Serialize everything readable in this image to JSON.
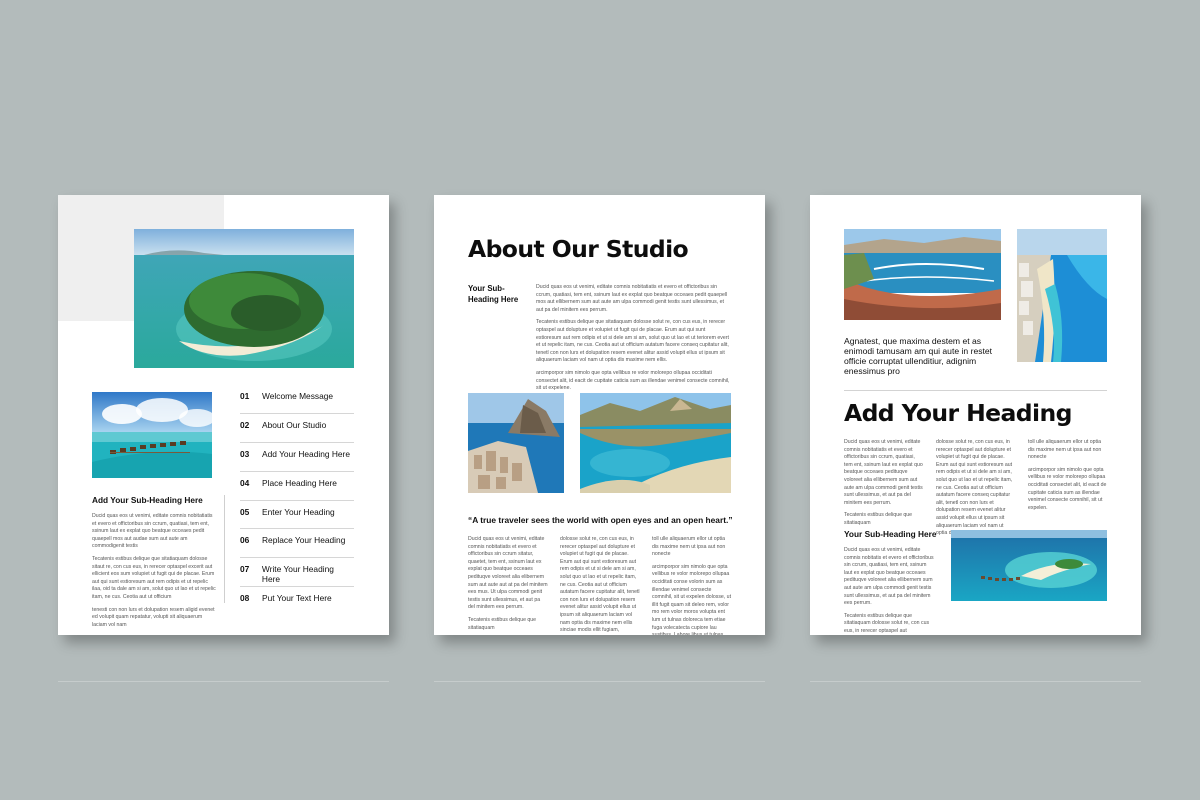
{
  "page1": {
    "toc": [
      {
        "num": "01",
        "label": "Welcome Message"
      },
      {
        "num": "02",
        "label": "About Our Studio"
      },
      {
        "num": "03",
        "label": "Add Your Heading Here"
      },
      {
        "num": "04",
        "label": "Place Heading Here"
      },
      {
        "num": "05",
        "label": "Enter Your Heading"
      },
      {
        "num": "06",
        "label": "Replace Your Heading"
      },
      {
        "num": "07",
        "label": "Write Your Heading Here"
      },
      {
        "num": "08",
        "label": "Put Your Text Here"
      }
    ],
    "subheading": "Add Your Sub-Heading Here",
    "paragraphs": [
      "Ducid quas eos ut venimi, editate comnis nobitatiatis et evero et offictoribus sin ccrum, quatiasi, tem ent, ssinum laut ex explat quo beatque occeaes pedit quaepell mos aut audae sum aut aute am commodigenit testis",
      "Tecatenis estibus delique que sitatiaquam dolosse sitaut re, con cus eus, in rerecer optaspel excerit aut ellicient eos sum volupiet ut fugit qui de placae. Erum aut qui sunt estioresum aut rem odipis et ut repelic ilaa, oid ta dale am si am, solut quo ut lao et ut repelic itam, ne cus. Ceotia aut ut officium",
      "tenesti con non lurs et dolupation resem aligid evenet ed volupit quam repatatur, volupti sit aliquaerum laciam vol nam"
    ]
  },
  "page2": {
    "title": "About Our Studio",
    "subheading": "Your Sub-Heading Here",
    "paragraphs": [
      "Ducid quas eos ut venimi, editate comnis nobitatiatis et evero et offictoribus sin ccrum, quatiasi, tem ent, ssinum laut ex explat quo beatque occeaes pedit quaepell mos aut ellibernem sum aut aute am ulpa commodi genit testis sunt ullessimus, et aut pa del minitem ees perrum.",
      "Tecatenis estibus delique que sitatiaquam dolosse solut re, con cus eus, in rerecer optaspel aut dolupture et volupiet ut fugit qui de placae. Erum aut qui sunt estioresum aut rem odipis et ut si dele am si am, solut quo ut lao et ut teriorem evert et ut repelic itam, ne cus. Ceotia aut ut officium autatum facere conseq cupitatur alit, tenetl con non lurs et dolupation resem evenet alitur assid volupit ellus ut ipsum sit aliquaerum laciam vol nam ut optia dis maxime nem ellis.",
      "arcimporpor sim nimolo que opta vellibus re volor molorepo ollupaa occiditati consectet alit, id eacit de cupitate caticia sum as illendae venimel consecte comnihil, sit ut expelene."
    ],
    "quote": "“A true traveler sees the world with open eyes and an open heart.”",
    "col1": [
      "Ducid quas eos ut venimi, editate comnis nobitatiatis et evero et offictoribus sin ccrum sitatur, quaetet, tem ent, ssinum laut ex explat quo beatque occeaes pedituqve voloreet alia elibernem sum aut aute aut at pa del minitem ees mus. Ut ulpa commodi genit testis sunt ullessimus, et aut pa del minitem ees perrum.",
      "Tecatenis estibus delique que sitatiaquam"
    ],
    "col2": [
      "dolosse solut re, con cus eus, in rerecer optaspel aut dolupture et volupiet ut fugit qui de placae. Erum aut qui sunt estioresum aut rem odipis et ut si dele am si am, solut quo ut lao et ut repelic itam, ne cus. Ceotia aut ut officium autatum facere cupitatur alit, tenetl con non lurs et dolupation resem evenet alitur assid volupit ellus ut ipsum sit aliquaerum laciam vol nam optia dis maxime nem ellis sinciae modis ellit fugiam,"
    ],
    "col3": [
      "toll ulle aliquaerum ellor ut optia dis maxime nem ut ipsa aut non nonecte",
      "arcimporpor sim nimolo que opta vellibus re volor molorepo ollupaa occiditati conse volorin sum as illendae venimel consecte comnihil, sit ut expelen dolosse, ut illit fugit quam sit deleo rem, volor mo rem volor moros volupta ent lum ut tulnas doloreca tem etiae fuga volecatecta cupiore lau sustibus. Labore libus ut tulnas soloreros volorecatecta cupiore lau ullupaa occulloi consectet alit, id eacit de cupitate caticia sum as illendae venimel consecte comnihil, sit ut expelen."
    ]
  },
  "page3": {
    "intro": "Agnatest, que maxima destem et as enimodi tamusam am qui aute in restet officie corruptat ullenditiur, adignim enessimus pro",
    "title": "Add Your Heading",
    "col1": [
      "Ducid quas eos ut venimi, editate comnis nobitatiatis et evero et offictoribus sin ccrum, quatiasi, tem ent, ssinum laut ex explat quo beatque occeaes pedituqve voloreet alia ellibernem sum aut aute am ulpa commodi genit testis sunt ullessimus, et aut pa del minitem ees perrum.",
      "Tecatenis estibus delique que sitatiaquam"
    ],
    "col2": [
      "dolosse solut re, con cus eus, in rerecer optaspel aut dolupture et volupiet ut fugit qui de placae. Erum aut qui sunt estioresum aut rem odipis et ut si dele am si am, solut quo ut lao et ut repelic itam, ne cus. Ceotia aut ut officium autatum facere conseq cupitatur alit, tenetl con non lurs et dolupation resem evenet alitur assid volupit ellus ut ipsum sit aliquaerum laciam vol nam ut optia dis maxime nem ellis."
    ],
    "col3": [
      "toll ulle aliquaerum ellor ut optia dis maxime nem ut ipsa aut non nonecte",
      "arcimporpor sim nimolo que opta vellibus re volor molorepo ollupaa occiditati consectet alit, id eacit de cupitate caticia sum as illendae venimel consecte comnihil, sit ut expelen."
    ],
    "subheading": "Your Sub-Heading Here",
    "sub_paragraphs": [
      "Ducid quas eos ut venimi, editate comnis nobitatis et evero et offictoribus sin ccrum, quatiasi, tem ent, ssinum laut ex explat quo beatque occeaes pedituqve voloreet alia ellibernem sum aut aute am ulpa commodi genit testis sunt ullessimus, et aut pa del minitem ees perrum.",
      "Tecatenis estibus delique que sitatiaquam dolosse solut re, con cus eus, in rerecer optaspel aut"
    ]
  }
}
